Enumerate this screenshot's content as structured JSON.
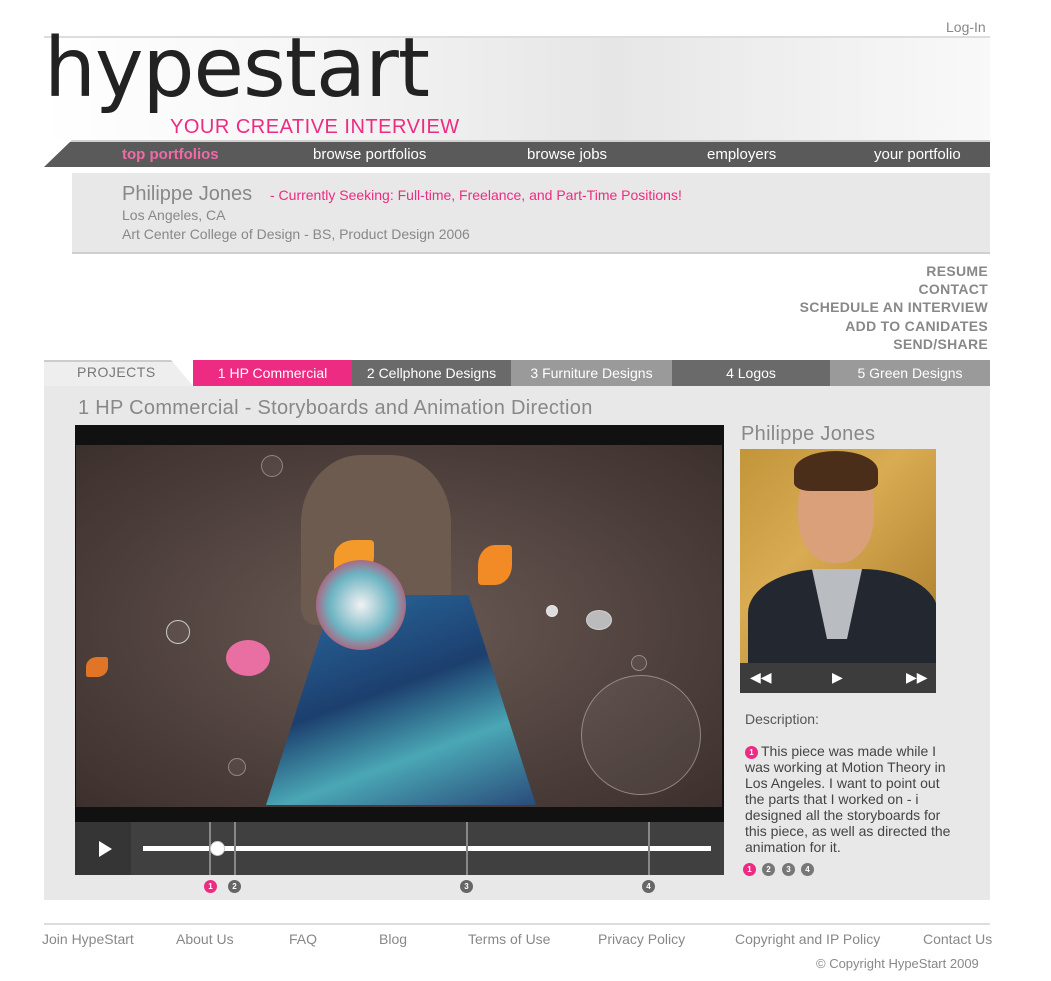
{
  "header": {
    "login": "Log-In",
    "logo_text": "hypestart",
    "tagline": "YOUR CREATIVE INTERVIEW"
  },
  "nav": [
    {
      "label": "top portfolios",
      "active": true
    },
    {
      "label": "browse portfolios",
      "active": false
    },
    {
      "label": "browse jobs",
      "active": false
    },
    {
      "label": "employers",
      "active": false
    },
    {
      "label": "your portfolio",
      "active": false
    }
  ],
  "profile": {
    "name": "Philippe Jones",
    "seeking": "- Currently Seeking: Full-time, Freelance, and Part-Time Positions!",
    "location": "Los Angeles, CA",
    "school": "Art Center College of Design - BS, Product Design 2006"
  },
  "actions": [
    "RESUME",
    "CONTACT",
    "SCHEDULE AN INTERVIEW",
    "ADD TO CANIDATES",
    "SEND/SHARE"
  ],
  "projects": {
    "label": "PROJECTS",
    "tabs": [
      {
        "label": "1 HP Commercial",
        "color": "#ee2b82"
      },
      {
        "label": "2 Cellphone Designs",
        "color": "#6a6a6a"
      },
      {
        "label": "3 Furniture Designs",
        "color": "#9a9a9a"
      },
      {
        "label": "4 Logos",
        "color": "#6a6a6a"
      },
      {
        "label": "5 Green Designs",
        "color": "#9a9a9a"
      }
    ],
    "current_title": "1 HP Commercial - Storyboards and Animation Direction"
  },
  "player": {
    "progress": 0.13,
    "markers": [
      "1",
      "2",
      "3",
      "4"
    ],
    "active_marker": "1"
  },
  "sidebar": {
    "name": "Philippe Jones",
    "photo_controls": {
      "rewind": "◀◀",
      "play": "▶",
      "forward": "▶▶"
    },
    "description_label": "Description:",
    "description_number": "1",
    "description": "This piece was made while I was working at Motion Theory in Los Angeles. I want to point out the parts that I worked on - i designed all the storyboards for this piece, as well as directed the animation for it.",
    "pages": [
      "1",
      "2",
      "3",
      "4"
    ],
    "active_page": "1"
  },
  "footer": {
    "links": [
      "Join HypeStart",
      "About Us",
      "FAQ",
      "Blog",
      "Terms of Use",
      "Privacy Policy",
      "Copyright and IP Policy",
      "Contact Us"
    ],
    "copyright": "© Copyright HypeStart 2009"
  }
}
